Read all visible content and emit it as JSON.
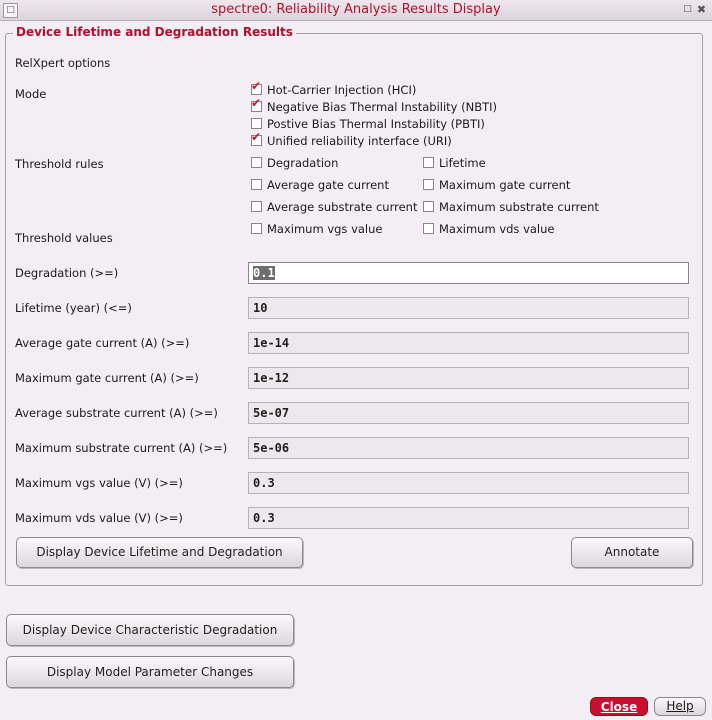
{
  "window": {
    "title": "spectre0: Reliability Analysis Results Display"
  },
  "group": {
    "title": "Device Lifetime and Degradation Results"
  },
  "relxpert_label": "RelXpert options",
  "mode": {
    "label": "Mode",
    "options": [
      {
        "label": "Hot-Carrier Injection (HCI)",
        "checked": true
      },
      {
        "label": "Negative Bias Thermal Instability (NBTI)",
        "checked": true
      },
      {
        "label": "Postive Bias Thermal Instability (PBTI)",
        "checked": false
      },
      {
        "label": "Unified reliability interface (URI)",
        "checked": true
      }
    ]
  },
  "threshold_rules": {
    "label": "Threshold rules",
    "options": [
      {
        "label": "Degradation",
        "checked": false
      },
      {
        "label": "Lifetime",
        "checked": false
      },
      {
        "label": "Average gate current",
        "checked": false
      },
      {
        "label": "Maximum gate current",
        "checked": false
      },
      {
        "label": "Average substrate current",
        "checked": false
      },
      {
        "label": "Maximum substrate current",
        "checked": false
      },
      {
        "label": "Maximum vgs value",
        "checked": false
      },
      {
        "label": "Maximum vds value",
        "checked": false
      }
    ]
  },
  "threshold_values": {
    "label": "Threshold values",
    "fields": [
      {
        "label": "Degradation (>=)",
        "value": "0.1"
      },
      {
        "label": "Lifetime (year) (<=)",
        "value": "10"
      },
      {
        "label": "Average gate current (A) (>=)",
        "value": "1e-14"
      },
      {
        "label": "Maximum gate current (A) (>=)",
        "value": "1e-12"
      },
      {
        "label": "Average substrate current (A) (>=)",
        "value": "5e-07"
      },
      {
        "label": "Maximum substrate current (A) (>=)",
        "value": "5e-06"
      },
      {
        "label": "Maximum vgs value (V) (>=)",
        "value": "0.3"
      },
      {
        "label": "Maximum vds value (V) (>=)",
        "value": "0.3"
      }
    ]
  },
  "buttons": {
    "display_lifetime": "Display Device Lifetime and Degradation",
    "annotate": "Annotate",
    "display_characteristic": "Display Device Characteristic Degradation",
    "display_model_param": "Display Model Parameter Changes",
    "close": "Close",
    "help": "Help"
  },
  "colors": {
    "accent": "#c8102e",
    "title_text": "#b0102a",
    "background": "#f3eef3"
  }
}
